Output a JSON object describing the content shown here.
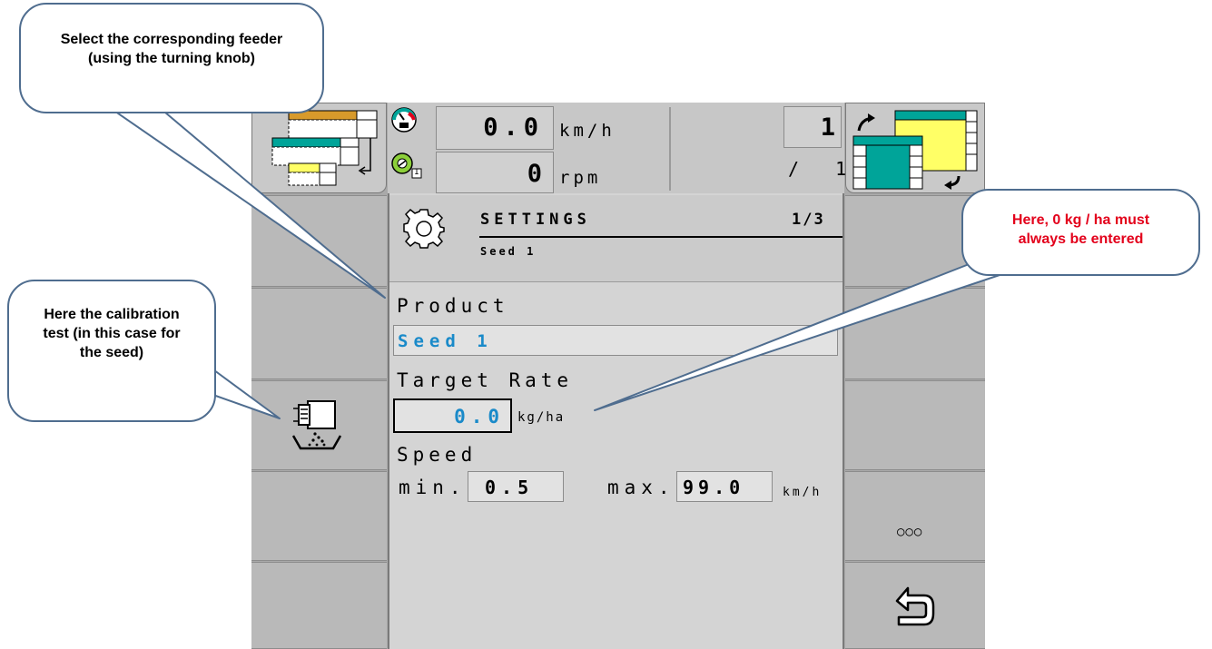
{
  "header": {
    "speed_value": "0.0",
    "speed_unit": "km/h",
    "rpm_value": "0",
    "rpm_unit": "rpm",
    "rpm_index": "1",
    "page_big": "1",
    "page_sub": "/ 1"
  },
  "settings": {
    "title": "SETTINGS",
    "page": "1/3",
    "subtitle": "Seed 1"
  },
  "form": {
    "product_label": "Product",
    "product_value": "Seed 1",
    "target_rate_label": "Target Rate",
    "target_rate_value": "0.0",
    "target_rate_unit": "kg/ha",
    "speed_label": "Speed",
    "min_label": "min.",
    "min_value": "0.5",
    "max_label": "max.",
    "max_value": "99.0",
    "speed_unit": "km/h"
  },
  "softkeys": {
    "more_label": "○○○"
  },
  "callouts": {
    "feeder": "Select the corresponding feeder (using the turning knob)",
    "calibration": "Here the calibration test (in this case for the seed)",
    "rate": "Here, 0 kg / ha must always be entered"
  },
  "colors": {
    "accent_blue": "#1a8ac9",
    "callout_red": "#e3001b",
    "callout_border": "#4f6d8f",
    "bin_teal": "#00a499",
    "bin_yellow": "#ffff66",
    "bin_orange": "#d89a2b"
  }
}
